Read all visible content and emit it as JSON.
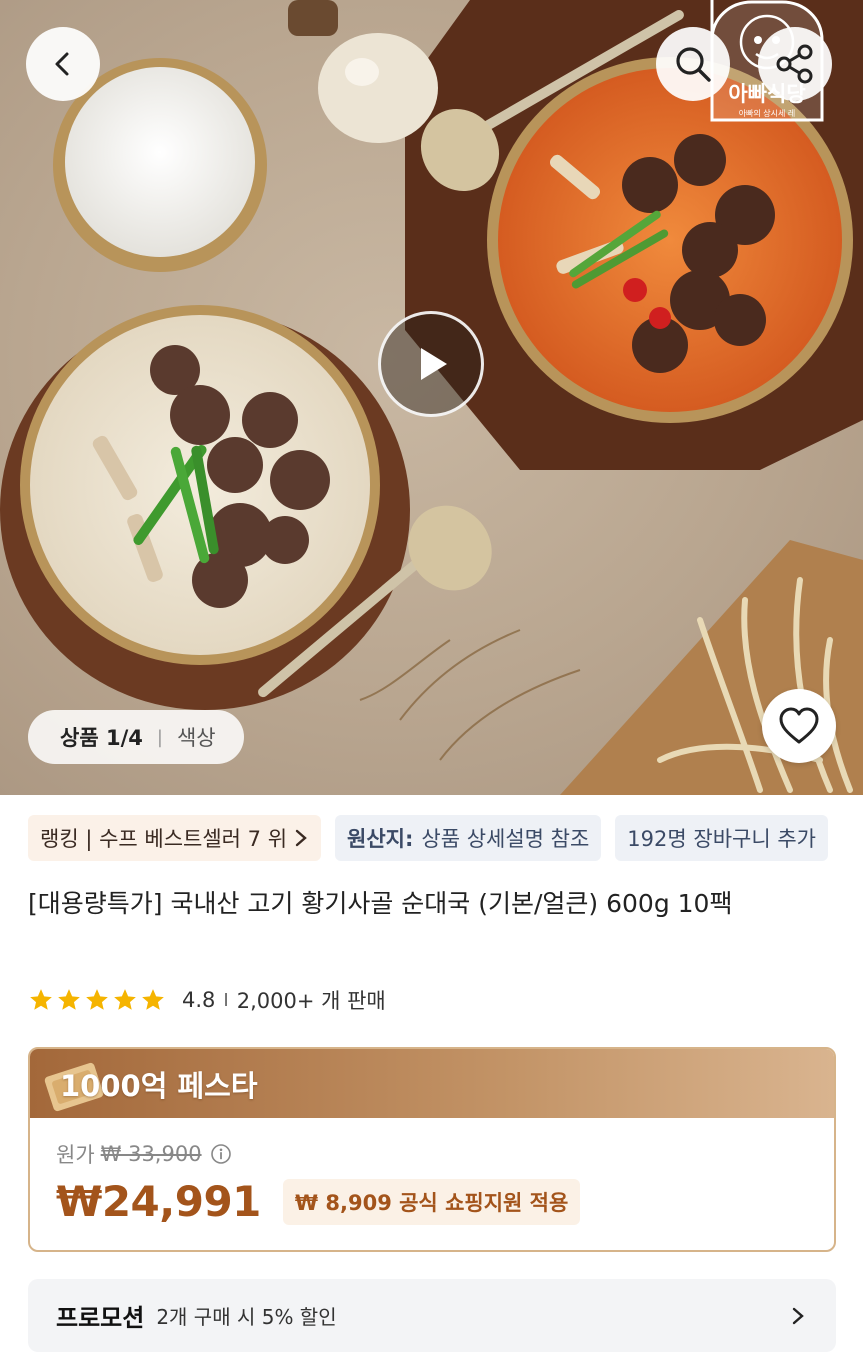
{
  "hero": {
    "image_indicator": {
      "current": "상품 1/4",
      "separator": "|",
      "color_tab": "색상"
    },
    "brand_logo": {
      "name": "아빠식당",
      "subtitle": "아빠의 상시세 레"
    },
    "icons": {
      "back": "chevron-left-icon",
      "search": "search-icon",
      "share": "share-icon",
      "play": "play-icon",
      "like": "heart-icon"
    }
  },
  "chips": {
    "rank": "랭킹 | 수프 베스트셀러 7 위",
    "origin_label": "원산지:",
    "origin_value": "상품 상세설명 참조",
    "cart": "192명 장바구니 추가"
  },
  "product": {
    "title": "[대용량특가] 국내산 고기 황기사골 순대국 (기본/얼큰) 600g 10팩",
    "rating": "4.8",
    "rating_separator": "I",
    "sales": "2,000+ 개 판매",
    "star_count": 5
  },
  "price": {
    "festa_label": "1000억 페스타",
    "original_label": "원가",
    "original_price": "₩ 33,900",
    "sale_price": "₩24,991",
    "support_text": "₩ 8,909 공식 쇼핑지원 적용"
  },
  "promotion": {
    "label": "프로모션",
    "description": "2개 구매 시 5% 할인"
  },
  "colors": {
    "accent": "#a3541b",
    "star": "#f5b400",
    "festa_gradient_start": "#a3683a",
    "festa_gradient_end": "#d9b48f"
  }
}
